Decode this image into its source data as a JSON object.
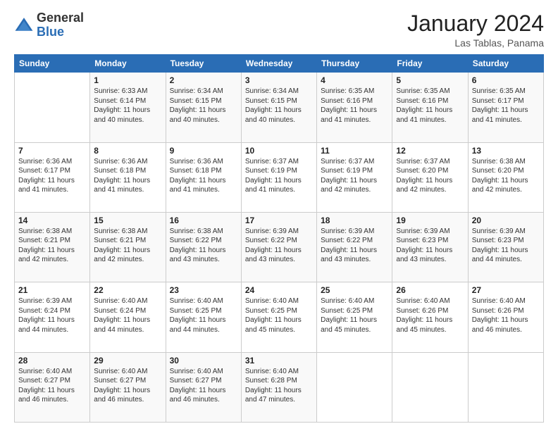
{
  "header": {
    "logo_general": "General",
    "logo_blue": "Blue",
    "month_title": "January 2024",
    "location": "Las Tablas, Panama"
  },
  "weekdays": [
    "Sunday",
    "Monday",
    "Tuesday",
    "Wednesday",
    "Thursday",
    "Friday",
    "Saturday"
  ],
  "weeks": [
    [
      {
        "day": "",
        "info": ""
      },
      {
        "day": "1",
        "info": "Sunrise: 6:33 AM\nSunset: 6:14 PM\nDaylight: 11 hours\nand 40 minutes."
      },
      {
        "day": "2",
        "info": "Sunrise: 6:34 AM\nSunset: 6:15 PM\nDaylight: 11 hours\nand 40 minutes."
      },
      {
        "day": "3",
        "info": "Sunrise: 6:34 AM\nSunset: 6:15 PM\nDaylight: 11 hours\nand 40 minutes."
      },
      {
        "day": "4",
        "info": "Sunrise: 6:35 AM\nSunset: 6:16 PM\nDaylight: 11 hours\nand 41 minutes."
      },
      {
        "day": "5",
        "info": "Sunrise: 6:35 AM\nSunset: 6:16 PM\nDaylight: 11 hours\nand 41 minutes."
      },
      {
        "day": "6",
        "info": "Sunrise: 6:35 AM\nSunset: 6:17 PM\nDaylight: 11 hours\nand 41 minutes."
      }
    ],
    [
      {
        "day": "7",
        "info": "Sunrise: 6:36 AM\nSunset: 6:17 PM\nDaylight: 11 hours\nand 41 minutes."
      },
      {
        "day": "8",
        "info": "Sunrise: 6:36 AM\nSunset: 6:18 PM\nDaylight: 11 hours\nand 41 minutes."
      },
      {
        "day": "9",
        "info": "Sunrise: 6:36 AM\nSunset: 6:18 PM\nDaylight: 11 hours\nand 41 minutes."
      },
      {
        "day": "10",
        "info": "Sunrise: 6:37 AM\nSunset: 6:19 PM\nDaylight: 11 hours\nand 41 minutes."
      },
      {
        "day": "11",
        "info": "Sunrise: 6:37 AM\nSunset: 6:19 PM\nDaylight: 11 hours\nand 42 minutes."
      },
      {
        "day": "12",
        "info": "Sunrise: 6:37 AM\nSunset: 6:20 PM\nDaylight: 11 hours\nand 42 minutes."
      },
      {
        "day": "13",
        "info": "Sunrise: 6:38 AM\nSunset: 6:20 PM\nDaylight: 11 hours\nand 42 minutes."
      }
    ],
    [
      {
        "day": "14",
        "info": "Sunrise: 6:38 AM\nSunset: 6:21 PM\nDaylight: 11 hours\nand 42 minutes."
      },
      {
        "day": "15",
        "info": "Sunrise: 6:38 AM\nSunset: 6:21 PM\nDaylight: 11 hours\nand 42 minutes."
      },
      {
        "day": "16",
        "info": "Sunrise: 6:38 AM\nSunset: 6:22 PM\nDaylight: 11 hours\nand 43 minutes."
      },
      {
        "day": "17",
        "info": "Sunrise: 6:39 AM\nSunset: 6:22 PM\nDaylight: 11 hours\nand 43 minutes."
      },
      {
        "day": "18",
        "info": "Sunrise: 6:39 AM\nSunset: 6:22 PM\nDaylight: 11 hours\nand 43 minutes."
      },
      {
        "day": "19",
        "info": "Sunrise: 6:39 AM\nSunset: 6:23 PM\nDaylight: 11 hours\nand 43 minutes."
      },
      {
        "day": "20",
        "info": "Sunrise: 6:39 AM\nSunset: 6:23 PM\nDaylight: 11 hours\nand 44 minutes."
      }
    ],
    [
      {
        "day": "21",
        "info": "Sunrise: 6:39 AM\nSunset: 6:24 PM\nDaylight: 11 hours\nand 44 minutes."
      },
      {
        "day": "22",
        "info": "Sunrise: 6:40 AM\nSunset: 6:24 PM\nDaylight: 11 hours\nand 44 minutes."
      },
      {
        "day": "23",
        "info": "Sunrise: 6:40 AM\nSunset: 6:25 PM\nDaylight: 11 hours\nand 44 minutes."
      },
      {
        "day": "24",
        "info": "Sunrise: 6:40 AM\nSunset: 6:25 PM\nDaylight: 11 hours\nand 45 minutes."
      },
      {
        "day": "25",
        "info": "Sunrise: 6:40 AM\nSunset: 6:25 PM\nDaylight: 11 hours\nand 45 minutes."
      },
      {
        "day": "26",
        "info": "Sunrise: 6:40 AM\nSunset: 6:26 PM\nDaylight: 11 hours\nand 45 minutes."
      },
      {
        "day": "27",
        "info": "Sunrise: 6:40 AM\nSunset: 6:26 PM\nDaylight: 11 hours\nand 46 minutes."
      }
    ],
    [
      {
        "day": "28",
        "info": "Sunrise: 6:40 AM\nSunset: 6:27 PM\nDaylight: 11 hours\nand 46 minutes."
      },
      {
        "day": "29",
        "info": "Sunrise: 6:40 AM\nSunset: 6:27 PM\nDaylight: 11 hours\nand 46 minutes."
      },
      {
        "day": "30",
        "info": "Sunrise: 6:40 AM\nSunset: 6:27 PM\nDaylight: 11 hours\nand 46 minutes."
      },
      {
        "day": "31",
        "info": "Sunrise: 6:40 AM\nSunset: 6:28 PM\nDaylight: 11 hours\nand 47 minutes."
      },
      {
        "day": "",
        "info": ""
      },
      {
        "day": "",
        "info": ""
      },
      {
        "day": "",
        "info": ""
      }
    ]
  ]
}
